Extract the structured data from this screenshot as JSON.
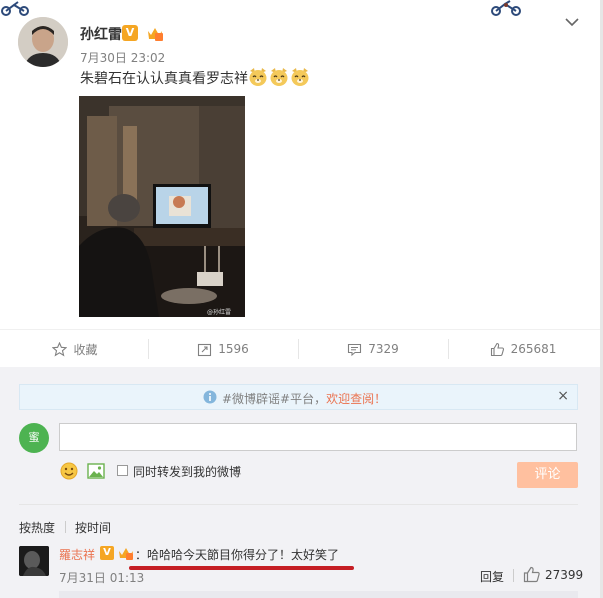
{
  "post": {
    "author": "孙红雷",
    "verified_badge": "V",
    "timestamp": "7月30日 23:02",
    "text": "朱碧石在认认真真看罗志祥",
    "emoji_icon": "doge-emoji",
    "photo_watermark": "@孙红雷"
  },
  "actions": [
    {
      "label": "收藏",
      "icon": "star-icon"
    },
    {
      "label": "1596",
      "icon": "repost-icon"
    },
    {
      "label": "7329",
      "icon": "comment-icon"
    },
    {
      "label": "265681",
      "icon": "like-icon"
    }
  ],
  "notice": {
    "prefix": "#微博辟谣#平台，",
    "link": "欢迎查阅！",
    "close": "×"
  },
  "composer": {
    "avatar_text": "蜜",
    "repost_checkbox_label": "同时转发到我的微博",
    "submit_label": "评论"
  },
  "sort": {
    "by_hot": "按热度",
    "by_time": "按时间"
  },
  "comment": {
    "author": "羅志祥",
    "verified_badge": "V",
    "text": "：哈哈哈今天節目你得分了！太好笑了",
    "timestamp": "7月31日 01:13",
    "reply_label": "回复",
    "like_count": "27399"
  },
  "colors": {
    "accent": "#eb7350",
    "verified": "#f5a623",
    "submit_disabled": "#ffc09f",
    "highlight_underline": "#c51e24"
  }
}
